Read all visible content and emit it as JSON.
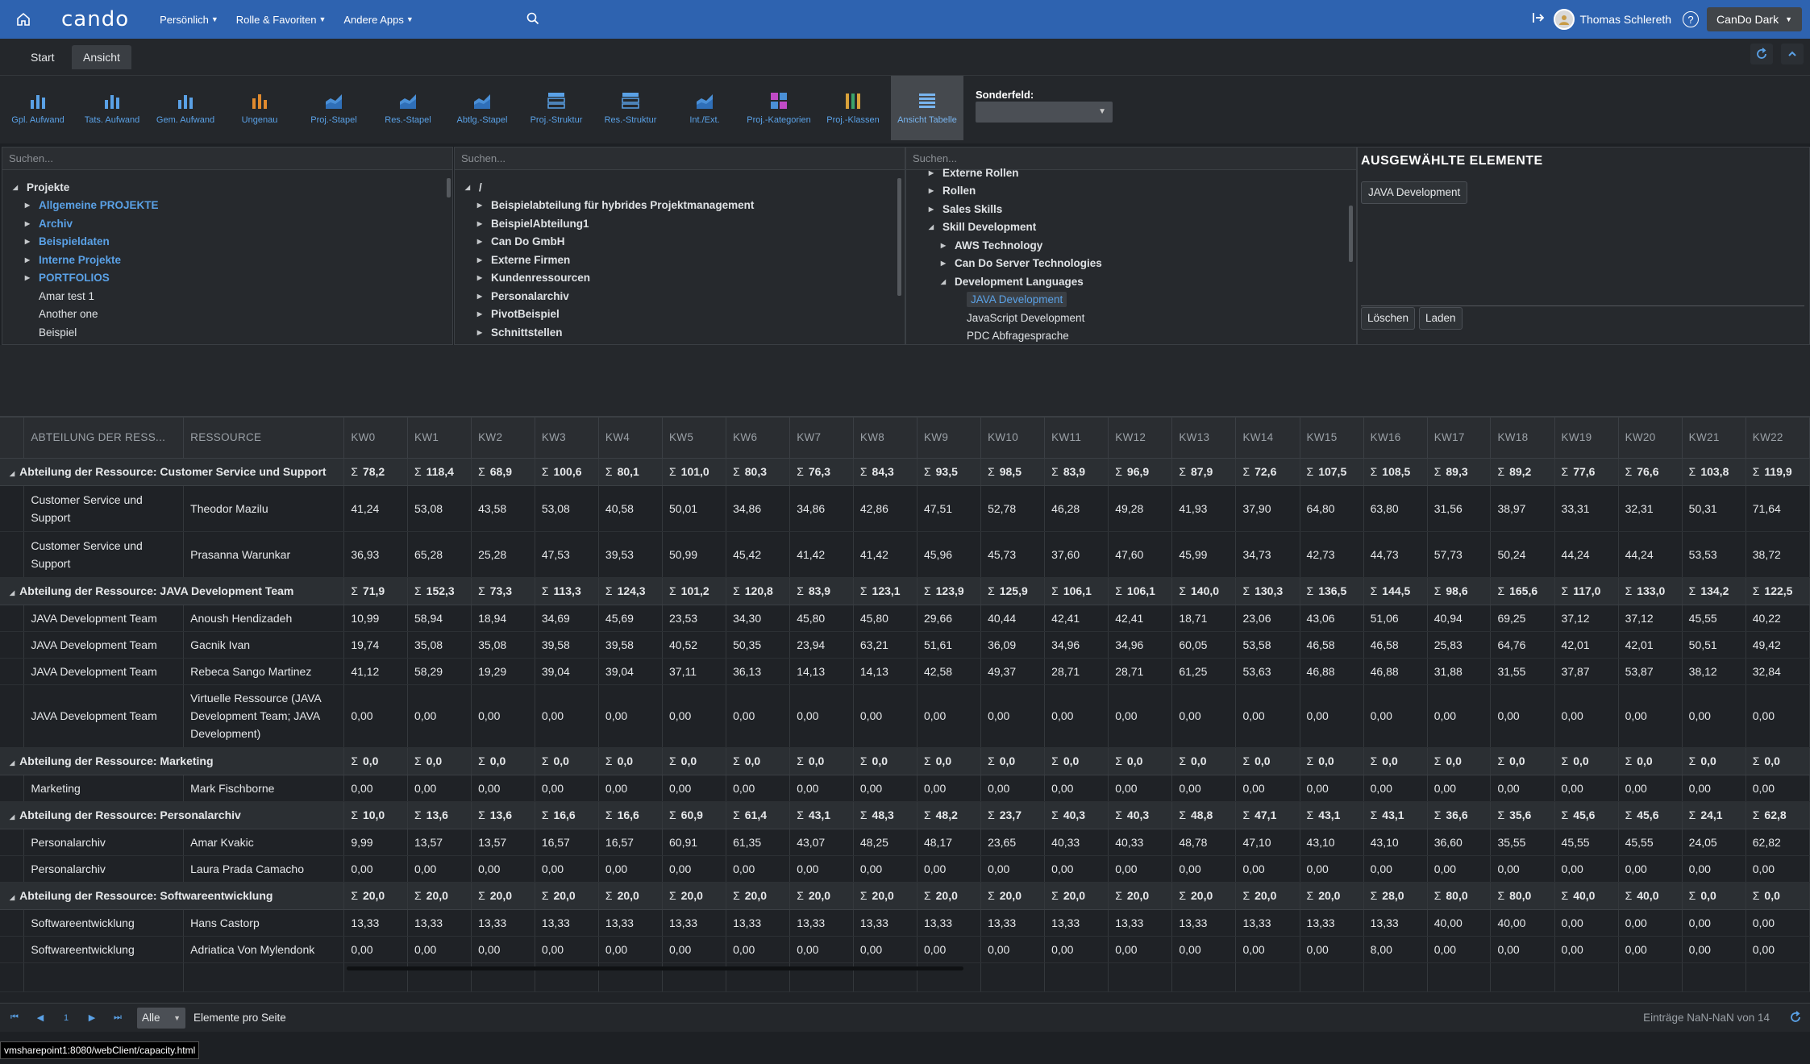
{
  "app": {
    "logo": "cando",
    "menus": [
      "Persönlich",
      "Rolle & Favoriten",
      "Andere Apps"
    ],
    "user": "Thomas Schlereth",
    "theme": "CanDo Dark"
  },
  "tabs": [
    "Start",
    "Ansicht"
  ],
  "ribbon": {
    "buttons": [
      {
        "label": "Gpl. Aufwand",
        "icon": "bar-chart-icon"
      },
      {
        "label": "Tats. Aufwand",
        "icon": "bar-chart-icon"
      },
      {
        "label": "Gem. Aufwand",
        "icon": "bar-chart-icon"
      },
      {
        "label": "Ungenau",
        "icon": "bar-chart-icon"
      },
      {
        "label": "Proj.-Stapel",
        "icon": "area-chart-icon"
      },
      {
        "label": "Res.-Stapel",
        "icon": "area-chart-icon"
      },
      {
        "label": "Abtlg.-Stapel",
        "icon": "area-chart-icon"
      },
      {
        "label": "Proj.-Struktur",
        "icon": "structure-icon"
      },
      {
        "label": "Res.-Struktur",
        "icon": "structure-icon"
      },
      {
        "label": "Int./Ext.",
        "icon": "area-chart-icon"
      },
      {
        "label": "Proj.-Kategorien",
        "icon": "categories-icon"
      },
      {
        "label": "Proj.-Klassen",
        "icon": "classes-icon"
      },
      {
        "label": "Ansicht Tabelle",
        "icon": "table-view-icon"
      }
    ],
    "sonderfeld_label": "Sonderfeld:",
    "sonderfeld_value": ""
  },
  "filters": {
    "search_placeholder": "Suchen...",
    "projects": [
      {
        "text": "Projekte",
        "style": "bold",
        "arrow": "expanded",
        "indent": 0
      },
      {
        "text": "Allgemeine PROJEKTE",
        "style": "blue",
        "arrow": "collapsed",
        "indent": 1
      },
      {
        "text": "Archiv",
        "style": "blue",
        "arrow": "collapsed",
        "indent": 1
      },
      {
        "text": "Beispieldaten",
        "style": "blue",
        "arrow": "collapsed",
        "indent": 1
      },
      {
        "text": "Interne Projekte",
        "style": "blue",
        "arrow": "collapsed",
        "indent": 1
      },
      {
        "text": "PORTFOLIOS",
        "style": "blue",
        "arrow": "collapsed",
        "indent": 1
      },
      {
        "text": "Amar test 1",
        "style": "plain",
        "arrow": "none",
        "indent": 1
      },
      {
        "text": "Another one",
        "style": "plain",
        "arrow": "none",
        "indent": 1
      },
      {
        "text": "Beispiel",
        "style": "plain",
        "arrow": "none",
        "indent": 1
      }
    ],
    "departments": [
      {
        "text": "/",
        "style": "bold",
        "arrow": "expanded",
        "indent": 0
      },
      {
        "text": "Beispielabteilung für hybrides Projektmanagement",
        "style": "bold",
        "arrow": "collapsed",
        "indent": 1
      },
      {
        "text": "BeispielAbteilung1",
        "style": "bold",
        "arrow": "collapsed",
        "indent": 1
      },
      {
        "text": "Can Do GmbH",
        "style": "bold",
        "arrow": "collapsed",
        "indent": 1
      },
      {
        "text": "Externe Firmen",
        "style": "bold",
        "arrow": "collapsed",
        "indent": 1
      },
      {
        "text": "Kundenressourcen",
        "style": "bold",
        "arrow": "collapsed",
        "indent": 1
      },
      {
        "text": "Personalarchiv",
        "style": "bold",
        "arrow": "collapsed",
        "indent": 1
      },
      {
        "text": "PivotBeispiel",
        "style": "bold",
        "arrow": "collapsed",
        "indent": 1
      },
      {
        "text": "Schnittstellen",
        "style": "bold",
        "arrow": "collapsed",
        "indent": 1
      }
    ],
    "skills": [
      {
        "text": "Externe Rollen",
        "style": "bold",
        "arrow": "collapsed",
        "indent": 1
      },
      {
        "text": "Rollen",
        "style": "bold",
        "arrow": "collapsed",
        "indent": 1
      },
      {
        "text": "Sales Skills",
        "style": "bold",
        "arrow": "collapsed",
        "indent": 1
      },
      {
        "text": "Skill Development",
        "style": "bold",
        "arrow": "expanded",
        "indent": 1
      },
      {
        "text": "AWS Technology",
        "style": "bold",
        "arrow": "collapsed",
        "indent": 2
      },
      {
        "text": "Can Do Server Technologies",
        "style": "bold",
        "arrow": "collapsed",
        "indent": 2
      },
      {
        "text": "Development Languages",
        "style": "bold",
        "arrow": "expanded",
        "indent": 2
      },
      {
        "text": "JAVA Development",
        "style": "selected",
        "arrow": "none",
        "indent": 3
      },
      {
        "text": "JavaScript Development",
        "style": "plain",
        "arrow": "none",
        "indent": 3
      },
      {
        "text": "PDC Abfragesprache",
        "style": "plain",
        "arrow": "none",
        "indent": 3
      }
    ]
  },
  "selected": {
    "title": "AUSGEWÄHLTE ELEMENTE",
    "items": [
      "JAVA Development"
    ],
    "delete_label": "Löschen",
    "load_label": "Laden"
  },
  "grid": {
    "col_dept": "ABTEILUNG DER RESS...",
    "col_res": "RESSOURCE",
    "weeks": [
      "KW0",
      "KW1",
      "KW2",
      "KW3",
      "KW4",
      "KW5",
      "KW6",
      "KW7",
      "KW8",
      "KW9",
      "KW10",
      "KW11",
      "KW12",
      "KW13",
      "KW14",
      "KW15",
      "KW16",
      "KW17",
      "KW18",
      "KW19",
      "KW20",
      "KW21",
      "KW22"
    ],
    "groups": [
      {
        "label": "Abteilung der Ressource: Customer Service und Support",
        "sums": [
          "78,2",
          "118,4",
          "68,9",
          "100,6",
          "80,1",
          "101,0",
          "80,3",
          "76,3",
          "84,3",
          "93,5",
          "98,5",
          "83,9",
          "96,9",
          "87,9",
          "72,6",
          "107,5",
          "108,5",
          "89,3",
          "89,2",
          "77,6",
          "76,6",
          "103,8",
          "119,9"
        ],
        "rows": [
          {
            "dept": "Customer Service und Support",
            "res": "Theodor Mazilu",
            "vals": [
              "41,24",
              "53,08",
              "43,58",
              "53,08",
              "40,58",
              "50,01",
              "34,86",
              "34,86",
              "42,86",
              "47,51",
              "52,78",
              "46,28",
              "49,28",
              "41,93",
              "37,90",
              "64,80",
              "63,80",
              "31,56",
              "38,97",
              "33,31",
              "32,31",
              "50,31",
              "71,64"
            ]
          },
          {
            "dept": "Customer Service und Support",
            "res": "Prasanna Warunkar",
            "vals": [
              "36,93",
              "65,28",
              "25,28",
              "47,53",
              "39,53",
              "50,99",
              "45,42",
              "41,42",
              "41,42",
              "45,96",
              "45,73",
              "37,60",
              "47,60",
              "45,99",
              "34,73",
              "42,73",
              "44,73",
              "57,73",
              "50,24",
              "44,24",
              "44,24",
              "53,53",
              "38,72"
            ]
          }
        ]
      },
      {
        "label": "Abteilung der Ressource: JAVA Development Team",
        "sums": [
          "71,9",
          "152,3",
          "73,3",
          "113,3",
          "124,3",
          "101,2",
          "120,8",
          "83,9",
          "123,1",
          "123,9",
          "125,9",
          "106,1",
          "106,1",
          "140,0",
          "130,3",
          "136,5",
          "144,5",
          "98,6",
          "165,6",
          "117,0",
          "133,0",
          "134,2",
          "122,5"
        ],
        "rows": [
          {
            "dept": "JAVA Development Team",
            "res": "Anoush Hendizadeh",
            "vals": [
              "10,99",
              "58,94",
              "18,94",
              "34,69",
              "45,69",
              "23,53",
              "34,30",
              "45,80",
              "45,80",
              "29,66",
              "40,44",
              "42,41",
              "42,41",
              "18,71",
              "23,06",
              "43,06",
              "51,06",
              "40,94",
              "69,25",
              "37,12",
              "37,12",
              "45,55",
              "40,22"
            ]
          },
          {
            "dept": "JAVA Development Team",
            "res": "Gacnik Ivan",
            "vals": [
              "19,74",
              "35,08",
              "35,08",
              "39,58",
              "39,58",
              "40,52",
              "50,35",
              "23,94",
              "63,21",
              "51,61",
              "36,09",
              "34,96",
              "34,96",
              "60,05",
              "53,58",
              "46,58",
              "46,58",
              "25,83",
              "64,76",
              "42,01",
              "42,01",
              "50,51",
              "49,42"
            ]
          },
          {
            "dept": "JAVA Development Team",
            "res": "Rebeca Sango Martinez",
            "vals": [
              "41,12",
              "58,29",
              "19,29",
              "39,04",
              "39,04",
              "37,11",
              "36,13",
              "14,13",
              "14,13",
              "42,58",
              "49,37",
              "28,71",
              "28,71",
              "61,25",
              "53,63",
              "46,88",
              "46,88",
              "31,88",
              "31,55",
              "37,87",
              "53,87",
              "38,12",
              "32,84"
            ]
          },
          {
            "dept": "JAVA Development Team",
            "res": "Virtuelle Ressource (JAVA Development Team; JAVA Development)",
            "vals": [
              "0,00",
              "0,00",
              "0,00",
              "0,00",
              "0,00",
              "0,00",
              "0,00",
              "0,00",
              "0,00",
              "0,00",
              "0,00",
              "0,00",
              "0,00",
              "0,00",
              "0,00",
              "0,00",
              "0,00",
              "0,00",
              "0,00",
              "0,00",
              "0,00",
              "0,00",
              "0,00"
            ]
          }
        ]
      },
      {
        "label": "Abteilung der Ressource: Marketing",
        "sums": [
          "0,0",
          "0,0",
          "0,0",
          "0,0",
          "0,0",
          "0,0",
          "0,0",
          "0,0",
          "0,0",
          "0,0",
          "0,0",
          "0,0",
          "0,0",
          "0,0",
          "0,0",
          "0,0",
          "0,0",
          "0,0",
          "0,0",
          "0,0",
          "0,0",
          "0,0",
          "0,0"
        ],
        "rows": [
          {
            "dept": "Marketing",
            "res": "Mark Fischborne",
            "vals": [
              "0,00",
              "0,00",
              "0,00",
              "0,00",
              "0,00",
              "0,00",
              "0,00",
              "0,00",
              "0,00",
              "0,00",
              "0,00",
              "0,00",
              "0,00",
              "0,00",
              "0,00",
              "0,00",
              "0,00",
              "0,00",
              "0,00",
              "0,00",
              "0,00",
              "0,00",
              "0,00"
            ]
          }
        ]
      },
      {
        "label": "Abteilung der Ressource: Personalarchiv",
        "sums": [
          "10,0",
          "13,6",
          "13,6",
          "16,6",
          "16,6",
          "60,9",
          "61,4",
          "43,1",
          "48,3",
          "48,2",
          "23,7",
          "40,3",
          "40,3",
          "48,8",
          "47,1",
          "43,1",
          "43,1",
          "36,6",
          "35,6",
          "45,6",
          "45,6",
          "24,1",
          "62,8"
        ],
        "rows": [
          {
            "dept": "Personalarchiv",
            "res": "Amar Kvakic",
            "vals": [
              "9,99",
              "13,57",
              "13,57",
              "16,57",
              "16,57",
              "60,91",
              "61,35",
              "43,07",
              "48,25",
              "48,17",
              "23,65",
              "40,33",
              "40,33",
              "48,78",
              "47,10",
              "43,10",
              "43,10",
              "36,60",
              "35,55",
              "45,55",
              "45,55",
              "24,05",
              "62,82"
            ]
          },
          {
            "dept": "Personalarchiv",
            "res": "Laura Prada Camacho",
            "vals": [
              "0,00",
              "0,00",
              "0,00",
              "0,00",
              "0,00",
              "0,00",
              "0,00",
              "0,00",
              "0,00",
              "0,00",
              "0,00",
              "0,00",
              "0,00",
              "0,00",
              "0,00",
              "0,00",
              "0,00",
              "0,00",
              "0,00",
              "0,00",
              "0,00",
              "0,00",
              "0,00"
            ]
          }
        ]
      },
      {
        "label": "Abteilung der Ressource: Softwareentwicklung",
        "sums": [
          "20,0",
          "20,0",
          "20,0",
          "20,0",
          "20,0",
          "20,0",
          "20,0",
          "20,0",
          "20,0",
          "20,0",
          "20,0",
          "20,0",
          "20,0",
          "20,0",
          "20,0",
          "20,0",
          "28,0",
          "80,0",
          "80,0",
          "40,0",
          "40,0",
          "0,0",
          "0,0"
        ],
        "rows": [
          {
            "dept": "Softwareentwicklung",
            "res": "Hans Castorp",
            "vals": [
              "13,33",
              "13,33",
              "13,33",
              "13,33",
              "13,33",
              "13,33",
              "13,33",
              "13,33",
              "13,33",
              "13,33",
              "13,33",
              "13,33",
              "13,33",
              "13,33",
              "13,33",
              "13,33",
              "13,33",
              "40,00",
              "40,00",
              "0,00",
              "0,00",
              "0,00",
              "0,00"
            ]
          },
          {
            "dept": "Softwareentwicklung",
            "res": "Adriatica Von Mylendonk",
            "vals": [
              "0,00",
              "0,00",
              "0,00",
              "0,00",
              "0,00",
              "0,00",
              "0,00",
              "0,00",
              "0,00",
              "0,00",
              "0,00",
              "0,00",
              "0,00",
              "0,00",
              "0,00",
              "0,00",
              "8,00",
              "0,00",
              "0,00",
              "0,00",
              "0,00",
              "0,00",
              "0,00"
            ]
          }
        ]
      }
    ]
  },
  "footer": {
    "page": "1",
    "page_size": "Alle",
    "per_page_label": "Elemente pro Seite",
    "info": "Einträge NaN-NaN von 14"
  },
  "statusbar": "vmsharepoint1:8080/webClient/capacity.html",
  "colors": {
    "brand": "#2e63b0",
    "link": "#5aa1e6"
  }
}
